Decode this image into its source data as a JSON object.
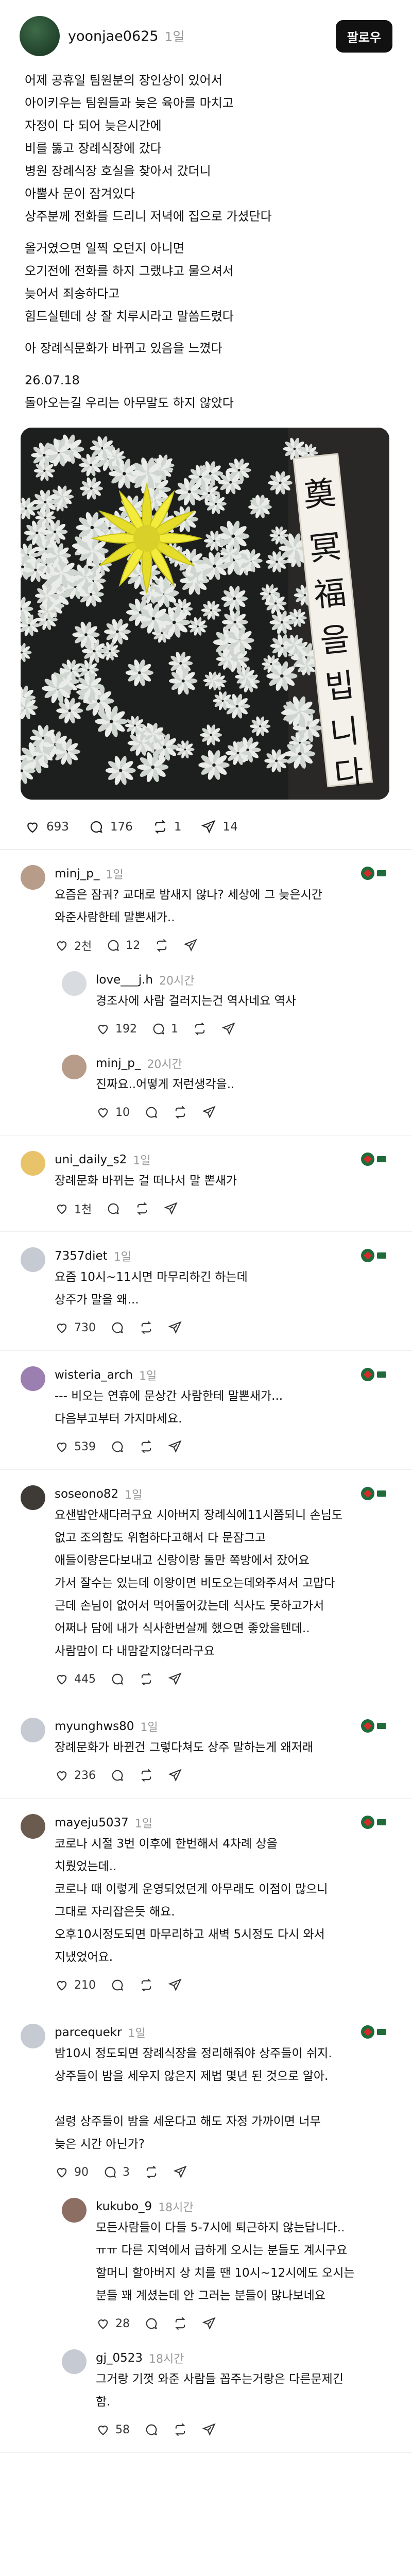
{
  "post": {
    "username": "yoonjae0625",
    "time": "1일",
    "follow_label": "팔로우",
    "lines": [
      "어제 공휴일 팀원분의 장인상이 있어서",
      "아이키우는 팀원들과 늦은 육아를 마치고",
      "자정이 다 되어 늦은시간에",
      "비를 뚫고 장례식장에 갔다",
      "병원 장례식장 호실을 찾아서 갔더니",
      "아뿔사 문이 잠겨있다",
      "상주분께 전화를 드리니 저녁에 집으로 가셨단다",
      "올거였으면 일찍 오던지 아니면",
      "오기전에 전화를 하지 그랬냐고 물으셔서",
      "늦어서 죄송하다고",
      "힘드실텐데 상 잘 치루시라고 말씀드렸다",
      "아 장례식문화가 바뀌고 있음을 느꼈다",
      "26.07.18",
      "돌아오는길 우리는 아무말도 하지 않았다"
    ],
    "image_banner_text": "奠 冥福을 빕니다",
    "stats": {
      "likes": "693",
      "comments": "176",
      "reposts": "1",
      "shares": "14"
    }
  },
  "colors": {
    "flag_green": "#1f6b3a",
    "flag_red": "#d62a2a"
  },
  "comments": [
    {
      "username": "minj_p_",
      "time": "1일",
      "reply": false,
      "avatar_color": "#b89c8a",
      "lines": [
        "요즘은 잠궈? 교대로 밤새지 않나? 세상에 그 늦은시간",
        "와준사람한테 말뽄새가.."
      ],
      "likes": "2천",
      "comments": "12",
      "reposts": "",
      "shares": "",
      "flag": true
    },
    {
      "username": "love___j.h",
      "time": "20시간",
      "reply": true,
      "avatar_color": "#d8dbe0",
      "lines": [
        "경조사에 사람 걸러지는건 역사네요 역사"
      ],
      "likes": "192",
      "comments": "1",
      "reposts": "",
      "shares": "",
      "flag": false
    },
    {
      "username": "minj_p_",
      "time": "20시간",
      "reply": true,
      "avatar_color": "#b89c8a",
      "lines": [
        "진짜요..어떻게 저런생각을.."
      ],
      "likes": "10",
      "comments": "",
      "reposts": "",
      "shares": "",
      "flag": false
    },
    {
      "username": "uni_daily_s2",
      "time": "1일",
      "reply": false,
      "avatar_color": "#e8c36a",
      "lines": [
        "장례문화 바뀌는 걸 떠나서 말 뽄새가"
      ],
      "likes": "1천",
      "comments": "",
      "reposts": "",
      "shares": "",
      "flag": true
    },
    {
      "username": "7357diet",
      "time": "1일",
      "reply": false,
      "avatar_color": "#c5cad3",
      "lines": [
        "요즘 10시~11시면 마무리하긴 하는데",
        "상주가 말을 왜..."
      ],
      "likes": "730",
      "comments": "",
      "reposts": "",
      "shares": "",
      "flag": true
    },
    {
      "username": "wisteria_arch",
      "time": "1일",
      "reply": false,
      "avatar_color": "#9a7fb0",
      "lines": [
        "--- 비오는 연휴에 문상간 사람한테 말뽄새가...",
        "다음부고부터 가지마세요."
      ],
      "likes": "539",
      "comments": "",
      "reposts": "",
      "shares": "",
      "flag": true
    },
    {
      "username": "soseono82",
      "time": "1일",
      "reply": false,
      "avatar_color": "#3e3a36",
      "lines": [
        "요샌밤안새다러구요 시아버지 장례식에11시쯤되니 손님도",
        "없고 조의함도 위험하다고해서 다 문잠그고",
        "애들이랑은다보내고 신랑이랑 둘만 쪽방에서 잤어요",
        "가서 잘수는 있는데 이왕이면 비도오는데와주셔서 고맙다",
        "근데 손님이 없어서 먹어둘어갔는데 식사도 못하고가서",
        "어쩌나 담에 내가 식사한번살께 했으면 좋았을텐데..",
        "사람맘이 다 내맘같지않더라구요"
      ],
      "likes": "445",
      "comments": "",
      "reposts": "",
      "shares": "",
      "flag": true
    },
    {
      "username": "myunghws80",
      "time": "1일",
      "reply": false,
      "avatar_color": "#c5cad3",
      "lines": [
        "장례문화가 바뀐건 그렇다쳐도 상주 말하는게 왜저래"
      ],
      "likes": "236",
      "comments": "",
      "reposts": "",
      "shares": "",
      "flag": true
    },
    {
      "username": "mayeju5037",
      "time": "1일",
      "reply": false,
      "avatar_color": "#6b5a4e",
      "lines": [
        "코로나 시절 3번 이후에 한번해서 4차례 상을",
        "치뤘었는데..",
        "코로나 때 이렇게 운영되었던게 아무래도 이점이 많으니",
        "그대로 자리잡은듯 해요.",
        "오후10시정도되면 마무리하고 새벽 5시정도 다시 와서",
        "지냈었어요."
      ],
      "likes": "210",
      "comments": "",
      "reposts": "",
      "shares": "",
      "flag": true
    },
    {
      "username": "parcequekr",
      "time": "1일",
      "reply": false,
      "avatar_color": "#c5cad3",
      "lines": [
        "밤10시 정도되면 장례식장을 정리해줘야 상주들이 쉬지.",
        "상주들이 밤을 세우지 않은지 제법 몇년 된 것으로 알아.",
        "",
        "설령 상주들이 밤을 세운다고 해도 자정 가까이면 너무",
        "늦은 시간 아닌가?"
      ],
      "likes": "90",
      "comments": "3",
      "reposts": "",
      "shares": "",
      "flag": true
    },
    {
      "username": "kukubo_9",
      "time": "18시간",
      "reply": true,
      "avatar_color": "#8d6e63",
      "lines": [
        "모든사람들이 다들 5-7시에 퇴근하지 않는답니다..",
        "ㅠㅠ 다른 지역에서 급하게 오시는 분들도 계시구요",
        "할머니 할아버지 상 치를 땐 10시~12시에도 오시는",
        "분들 꽤 계셨는데 안 그러는 분들이 많나보네요"
      ],
      "likes": "28",
      "comments": "",
      "reposts": "",
      "shares": "",
      "flag": false
    },
    {
      "username": "gj_0523",
      "time": "18시간",
      "reply": true,
      "avatar_color": "#c5cad3",
      "lines": [
        "그거랑 기껏 와준 사람들 꼽주는거랑은 다른문제긴",
        "함."
      ],
      "likes": "58",
      "comments": "",
      "reposts": "",
      "shares": "",
      "flag": false
    }
  ]
}
